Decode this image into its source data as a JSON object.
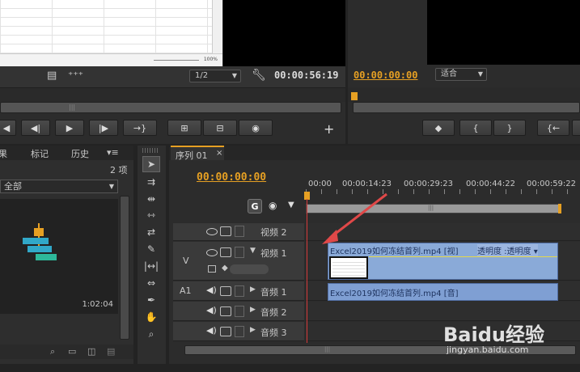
{
  "source_monitor": {
    "fraction": "1/2",
    "timecode": "00:00:56:19"
  },
  "program_monitor": {
    "timecode": "00:00:00:00",
    "fit": "适合"
  },
  "excel_preview": {
    "zoom": "100%"
  },
  "project_panel": {
    "tabs": [
      "果",
      "标记",
      "历史"
    ],
    "item_count": "2 项",
    "filter": "全部",
    "duration": "1:02:04"
  },
  "timeline": {
    "tab_label": "序列 01",
    "close": "×",
    "playhead_timecode": "00:00:00:00",
    "ruler_ticks": [
      "00:00",
      "00:00:14:23",
      "00:00:29:23",
      "00:00:44:22",
      "00:00:59:22"
    ],
    "tracks": {
      "v2": "视频 2",
      "v1": "视频 1",
      "a1": "音频 1",
      "a2": "音频 2",
      "a3": "音频 3"
    },
    "track_targets": {
      "v": "V",
      "a1": "A1"
    },
    "video_clip_label": "Excel2019如何冻结首列.mp4 [视]",
    "opacity_label": "透明度 :透明度 ▾",
    "audio_clip_label": "Excel2019如何冻结首列.mp4 [音]"
  },
  "watermark": {
    "brand": "Baidu经验",
    "url": "jingyan.baidu.com"
  },
  "colors": {
    "timecode": "#e6a023",
    "clip_video": "#8aaad8",
    "clip_audio": "#7f9fd3",
    "playhead": "#d63a3a",
    "arrow": "#e04848"
  }
}
